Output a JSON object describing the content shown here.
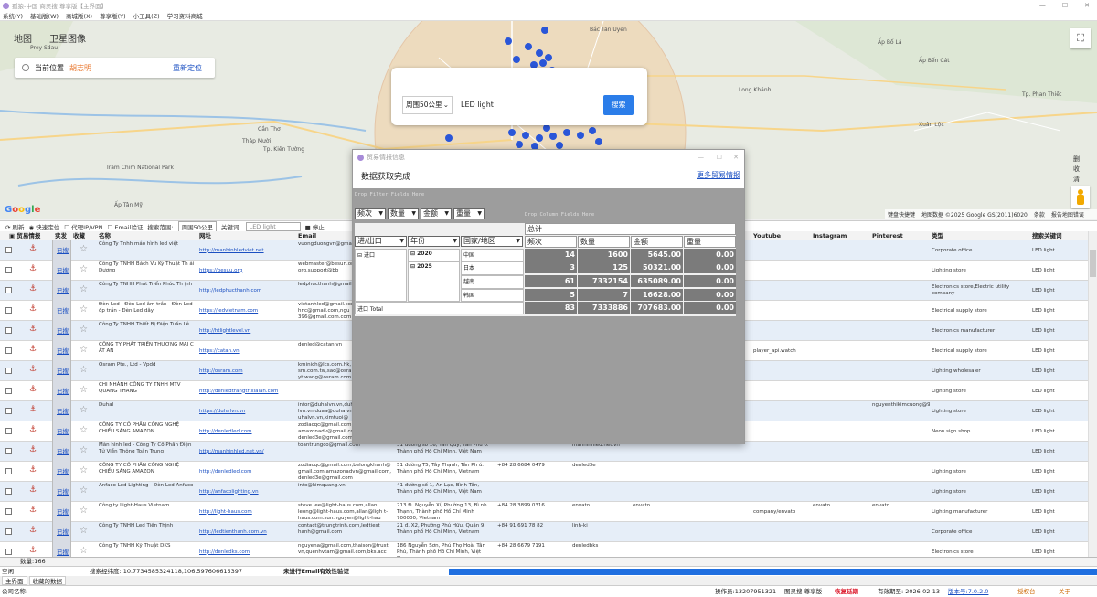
{
  "window": {
    "title": "孤狼-中国 商灵搜 尊享版【主界面】",
    "controls": [
      "—",
      "☐",
      "✕"
    ]
  },
  "menu": [
    "系统(Y)",
    "基础版(W)",
    "商城版(X)",
    "尊享版(Y)",
    "小工具(Z)",
    "学习资料商城"
  ],
  "map": {
    "tabs": {
      "map": "地图",
      "satellite": "卫星图像"
    },
    "location": {
      "label": "当前位置",
      "city": "胡志明",
      "relocate": "重新定位"
    },
    "search": {
      "radius": "周围50公里",
      "keyword": "LED light",
      "button": "搜索"
    },
    "right_menu": [
      "删",
      "收",
      "清",
      "上",
      "刷"
    ],
    "labels": [
      {
        "t": "Prey Sdau"
      },
      {
        "t": "Cần Thơ"
      },
      {
        "t": "Tháp Mười"
      },
      {
        "t": "Tràm Chim National Park"
      },
      {
        "t": "Tp. Kiên Tường"
      },
      {
        "t": "Ấp Tân Mỹ"
      },
      {
        "t": "Bắc Tân Uyên"
      },
      {
        "t": "Ấp Bố Lá"
      },
      {
        "t": "Ấp Bến Cát"
      },
      {
        "t": "Tp. Phan Thiết"
      },
      {
        "t": "Long Khánh"
      },
      {
        "t": "Xuân Lộc"
      }
    ],
    "footer": [
      "键盘快捷键",
      "地图数据 ©2025 Google GS(2011)6020",
      "条款",
      "报告地图错误"
    ],
    "logo": "Google"
  },
  "toolbar": [
    "刷新",
    "快速定位",
    "代理IP/VPN",
    "Email验证",
    "搜索范围:",
    "周围50公里",
    "关键词:",
    "LED light",
    "停止"
  ],
  "grid": {
    "columns": [
      "贸易情报",
      "实发",
      "收藏",
      "名称",
      "网址",
      "Email",
      "",
      "",
      "",
      "",
      "",
      "Youtube",
      "Instagram",
      "Pinterest",
      "类型",
      "搜索关键词"
    ],
    "rows": [
      {
        "name": "Công Ty Tnhh máo hình led việt",
        "site": "http://manhinhledviet.net",
        "email": "vuongduongvn@gmail.com",
        "addr": "",
        "phone": "",
        "c1": "",
        "c2": "",
        "yt": "",
        "ig": "",
        "pin": "",
        "type": "Corporate office",
        "kw": "LED light"
      },
      {
        "name": "Công Ty TNHH Bách Vu Ký Thuật Th ái Dương",
        "site": "https://besuu.org",
        "email": "webmaster@besun.org,info@besunenergy.com, org.support@bb",
        "addr": "",
        "phone": "",
        "c1": "",
        "c2": "",
        "yt": "",
        "ig": "",
        "pin": "",
        "type": "Lighting store",
        "kw": "LED light"
      },
      {
        "name": "Công Ty TNHH Phát Triển Phúc Th ịnh",
        "site": "http://ledphucthanh.com",
        "email": "ledphucthanh@gmail.com",
        "addr": "",
        "phone": "",
        "c1": "",
        "c2": "",
        "yt": "",
        "ig": "",
        "pin": "",
        "type": "Electronics store,Electric utility company",
        "kw": "LED light"
      },
      {
        "name": "Đèn Led - Đèn Led âm trần - Đèn Led ốp trần - Đèn Led dây",
        "site": "https://ledvietnam.com",
        "email": "vietanhled@gmail.com, hnc@gmail.com,ngu 396@gmail.com.com",
        "addr": "",
        "phone": "",
        "c1": "",
        "c2": "",
        "yt": "",
        "ig": "",
        "pin": "",
        "type": "Electrical supply store",
        "kw": "LED light"
      },
      {
        "name": "Công Ty TNHH Thiết Bị Điện Tuấn Lê",
        "site": "http://htlightlevel.vn",
        "email": "",
        "addr": "",
        "phone": "",
        "c1": "",
        "c2": "",
        "yt": "",
        "ig": "",
        "pin": "",
        "type": "Electronics manufacturer",
        "kw": "LED light"
      },
      {
        "name": "CÔNG TY PHÁT TRIỂN THƯƠNG MẠI C ÁT AN",
        "site": "https://catan.vn",
        "email": "denled@catan.vn",
        "addr": "",
        "phone": "",
        "c1": "",
        "c2": "",
        "yt": "player_api.watch",
        "ig": "",
        "pin": "",
        "type": "Electrical supply store",
        "kw": "LED light"
      },
      {
        "name": "Osram Pte., Ltd - Vpdd",
        "site": "http://osram.com",
        "email": "kminich@lcs.com.hk, sm.com.tw,sac@osram yt.wang@osram.com",
        "addr": "",
        "phone": "",
        "c1": "",
        "c2": "",
        "yt": "",
        "ig": "",
        "pin": "",
        "type": "Lighting wholesaler",
        "kw": "LED light"
      },
      {
        "name": "CHI NHÁNH CÔNG TY TNHH MTV QUANG THANG",
        "site": "http://denledtrangtrixiaian.com",
        "email": "",
        "addr": "",
        "phone": "",
        "c1": "",
        "c2": "",
        "yt": "",
        "ig": "",
        "pin": "",
        "type": "Lighting store",
        "kw": "LED light"
      },
      {
        "name": "Duhal",
        "site": "https://duhalvn.vn",
        "email": "infor@duhalvn.vn,duhal lvn.vn,duaa@duhalvn uhalvn.vn,kimtuoi@",
        "addr": "",
        "phone": "",
        "c1": "4",
        "c2": "",
        "yt": "",
        "ig": "",
        "pin": "nguyenthikimcuong@98.denled@duhalvn.create",
        "type": "Lighting store",
        "kw": "LED light"
      },
      {
        "name": "CÔNG TY CỔ PHẦN CÔNG NGHỆ CHIẾU SÁNG AMAZON",
        "site": "http://denledled.com",
        "email": "zodiacqc@gmail.com, amazonadv@gmail.com denled3e@gmail.com",
        "addr": "",
        "phone": "",
        "c1": "",
        "c2": "",
        "yt": "",
        "ig": "",
        "pin": "",
        "type": "Neon sign shop",
        "kw": "LED light"
      },
      {
        "name": "Màn hình led - Công Ty Cổ Phần Điện Tử Viễn Thông Toàn Trung",
        "site": "http://manhinhled.net.vn/",
        "email": "toantrungco@gmail.com",
        "addr": "31 đường số 16, Tân Quy, Tân Phú o. Thành phố Hồ Chí Minh, Việt Nam",
        "phone": "",
        "c1": "manhinhled.net.vn",
        "c2": "",
        "yt": "",
        "ig": "",
        "pin": "",
        "type": "",
        "kw": "LED light"
      },
      {
        "name": "CÔNG TY CỔ PHẦN CÔNG NGHỆ CHIẾU SÁNG AMAZON",
        "site": "http://denledled.com",
        "email": "zodiacqc@gmail.com,belongkhanh@ gmail.com,amazonadvn@gmail.com, denled3e@gmail.com",
        "addr": "51 đường T5, Tây Thạnh, Tân Ph ú. Thành phố Hồ Chí Minh, Vietnam",
        "phone": "+84 28 6684 0479",
        "c1": "denled3e",
        "c2": "",
        "yt": "",
        "ig": "",
        "pin": "",
        "type": "Lighting store",
        "kw": "LED light"
      },
      {
        "name": "Anfaco Led Lighting - Đèn Led Anfaco",
        "site": "http://anfacolighting.vn",
        "email": "info@kimquang.vn",
        "addr": "41 đường số 1, An Lạc, Bình Tân, Thành phố Hồ Chí Minh, Việt Nam",
        "phone": "",
        "c1": "",
        "c2": "",
        "yt": "",
        "ig": "",
        "pin": "",
        "type": "Lighting store",
        "kw": "LED light"
      },
      {
        "name": "Công ty Light-Haus Vietnam",
        "site": "http://light-haus.com",
        "email": "steve.lee@light-haus.com,allan leong@light-haus.com,allan@ligh t-haus.com.sun.nguyen@light-hau",
        "addr": "213 Đ. Nguyễn Xí, Phường 13, Bì nh Thạnh, Thành phố Hồ Chí Minh 700000, Vietnam",
        "phone": "+84 28 3899 0316",
        "c1": "envato",
        "c2": "envato",
        "yt": "company/envato",
        "ig": "envato",
        "pin": "envato",
        "type": "Lighting manufacturer",
        "kw": "LED light"
      },
      {
        "name": "Công Ty TNHH Led Tiến Thịnh",
        "site": "http://ledtienthanh.com.vn",
        "email": "contact@trungtrinh.com,ledtiest hanh@gmail.com",
        "addr": "21 đ. X2, Phường Phú Hữu, Quận 9. Thành phố Hồ Chí Minh, Vietnam",
        "phone": "+84 91 691 78 82",
        "c1": "linh-ki",
        "c2": "",
        "yt": "",
        "ig": "",
        "pin": "",
        "type": "Corporate office",
        "kw": "LED light"
      },
      {
        "name": "Công Ty TNHH Kỹ Thuật DKS",
        "site": "http://denledks.com",
        "email": "nguyena@gmail.com,thaison@trust, vn,quenhvtam@gmail.com,bks.acc",
        "addr": "186 Nguyễn Sơn, Phú Thọ Hoà, Tân Phú, Thành phố Hồ Chí Minh, Việt Nam",
        "phone": "+84 28 6679 7191",
        "c1": "denledbks",
        "c2": "",
        "yt": "",
        "ig": "",
        "pin": "",
        "type": "Electronics store",
        "kw": "LED light"
      }
    ],
    "searched_label": "已搜"
  },
  "countbar": "数量:166",
  "status": {
    "left": "空闲",
    "coords": "搜索经纬度: 10.7734585324118,106.597606615397",
    "mid": "未进行Email有效性验证"
  },
  "tabs": [
    "主界面",
    "收藏的数据"
  ],
  "footer": {
    "company": "公司名称:",
    "operator": "操作员:13207951321",
    "user": "图灵搜 尊享版",
    "status": "恢复延期",
    "expiry": "有效期至: 2026-02-13",
    "version": "版本号:7.0.2.0",
    "auth": "授权台",
    "about": "关于"
  },
  "dialog": {
    "title": "贸易情报信息",
    "heading": "数据获取完成",
    "link": "更多贸易情报",
    "filter_zone": "Drop Filter Fields Here",
    "column_zone": "Drop Column Fields Here",
    "data_fields": [
      "频次",
      "数量",
      "金额",
      "重量"
    ],
    "row_fields": [
      "进/出口",
      "年份",
      "国家/地区"
    ],
    "total_label": "总计",
    "table": {
      "dir": "进口",
      "years": [
        "2020",
        "2025"
      ],
      "countries": [
        "中国",
        "日本",
        "越南",
        "韩国"
      ],
      "values": [
        [
          "14",
          "1600",
          "5645.00",
          "0.00"
        ],
        [
          "3",
          "125",
          "50321.00",
          "0.00"
        ],
        [
          "61",
          "7332154",
          "635089.00",
          "0.00"
        ],
        [
          "5",
          "7",
          "16628.00",
          "0.00"
        ],
        [
          "83",
          "7333886",
          "707683.00",
          "0.00"
        ]
      ],
      "subtotal": "进口 Total"
    }
  }
}
